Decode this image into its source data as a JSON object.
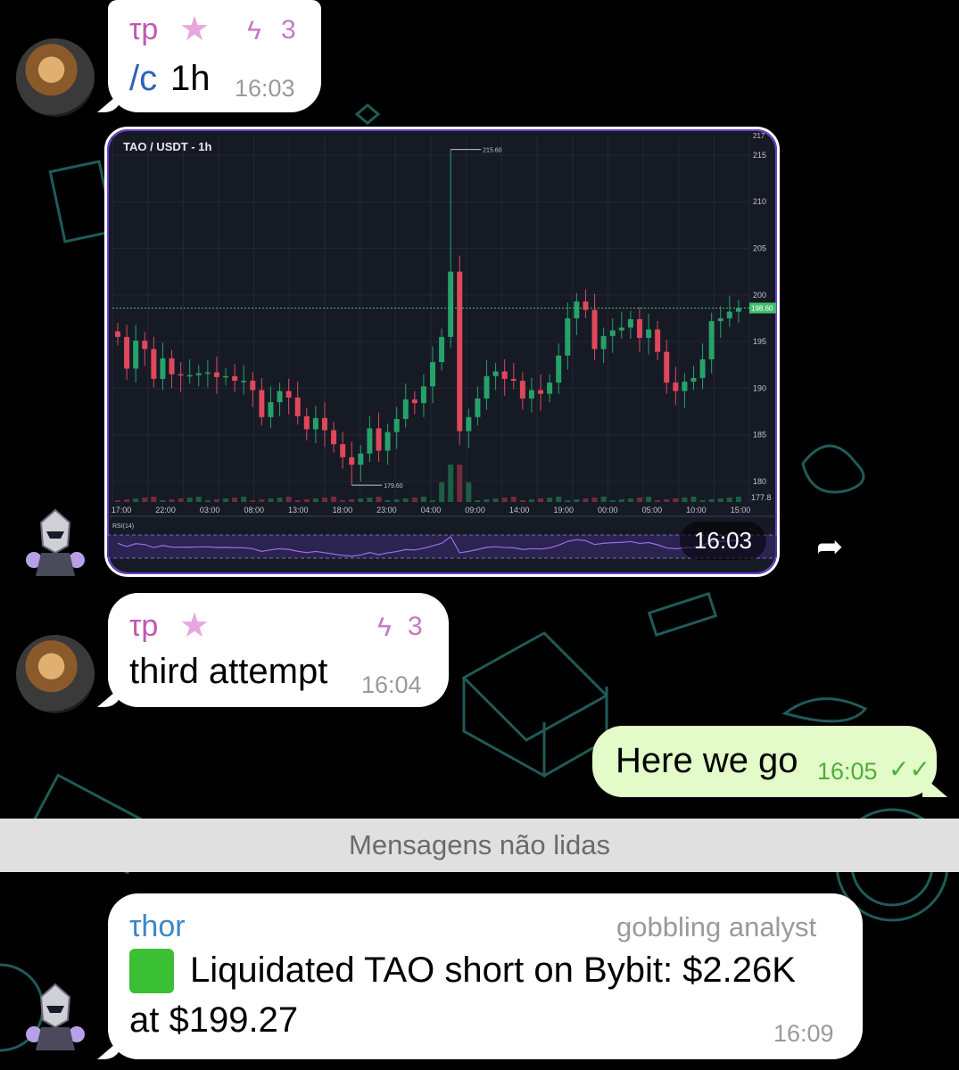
{
  "messages": {
    "m1": {
      "sender": "τp",
      "boost": "3",
      "command": "/c",
      "text": "1h",
      "time": "16:03"
    },
    "m2": {
      "time": "16:03"
    },
    "m3": {
      "sender": "τp",
      "boost": "3",
      "text": "third attempt",
      "time": "16:04"
    },
    "m4": {
      "text": "Here we go",
      "time": "16:05",
      "status": "read"
    },
    "m5": {
      "sender": "τhor",
      "role": "gobbling analyst",
      "icon": "🟩",
      "text_line1": "Liquidated TAO short on Bybit: $2.26K",
      "text_line2": "at $199.27",
      "time": "16:09"
    }
  },
  "unread_label": "Mensagens não lidas",
  "chart_data": {
    "type": "candlestick",
    "title": "TAO / USDT  - 1h",
    "x_ticks": [
      "17:00",
      "22:00",
      "03:00",
      "08:00",
      "13:00",
      "18:00",
      "23:00",
      "04:00",
      "09:00",
      "14:00",
      "19:00",
      "00:00",
      "05:00",
      "10:00",
      "15:00"
    ],
    "y_ticks": [
      215,
      210,
      205,
      200,
      195,
      190,
      185,
      180
    ],
    "ylim": [
      177.8,
      217
    ],
    "y_top_label": "217",
    "y_bottom_label": "177.8",
    "last_price": "198.60",
    "high_label": "215.60",
    "low_label": "179.60",
    "indicator_label": "RSI(14)",
    "closes": [
      195.5,
      192.1,
      195.1,
      194.2,
      191.0,
      193.2,
      191.5,
      191.4,
      191.4,
      191.6,
      191.7,
      191.2,
      191.3,
      190.8,
      190.8,
      189.8,
      186.9,
      188.5,
      189.7,
      189.0,
      187.0,
      185.6,
      186.8,
      185.5,
      184.0,
      182.6,
      181.8,
      183.0,
      185.7,
      183.3,
      185.3,
      186.7,
      188.8,
      188.4,
      190.2,
      192.8,
      195.5,
      202.5,
      185.4,
      186.9,
      188.9,
      191.3,
      191.8,
      191.0,
      190.8,
      188.9,
      189.8,
      189.4,
      190.6,
      193.5,
      197.5,
      199.3,
      198.4,
      194.2,
      195.6,
      196.2,
      196.5,
      197.4,
      195.4,
      196.3,
      193.9,
      190.6,
      189.7,
      190.7,
      191.1,
      193.1,
      197.2,
      197.5,
      198.2,
      198.6
    ],
    "highlights": {
      "high_index": 37,
      "high": 215.6,
      "low_index": 26,
      "low": 179.6
    }
  }
}
